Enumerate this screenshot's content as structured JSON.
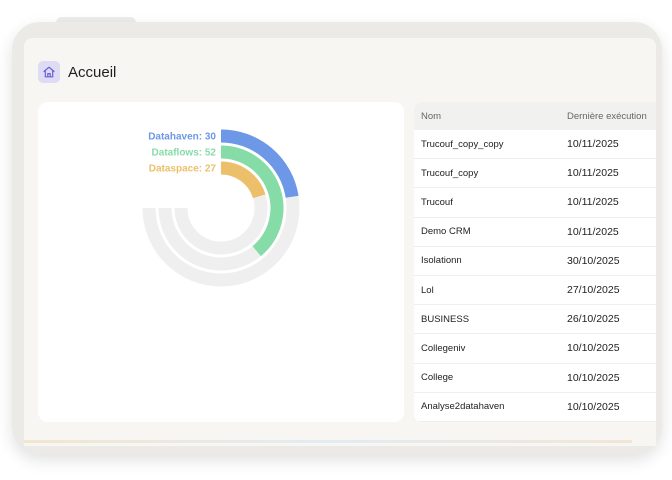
{
  "header": {
    "title": "Accueil",
    "icon": "home-icon",
    "icon_bg": "#dedbf4",
    "icon_color": "#6a5fd6"
  },
  "chart_data": {
    "type": "radial-bar",
    "max": 100,
    "track_color": "#efefef",
    "series": [
      {
        "name": "Datahaven",
        "value": 30,
        "label": "Datahaven: 30",
        "color": "#6d98e8"
      },
      {
        "name": "Dataflows",
        "value": 52,
        "label": "Dataflows: 52",
        "color": "#86dca6"
      },
      {
        "name": "Dataspace",
        "value": 27,
        "label": "Dataspace: 27",
        "color": "#ecc06a"
      }
    ]
  },
  "table": {
    "columns": [
      "Nom",
      "Dernière exécution"
    ],
    "rows": [
      {
        "name": "Trucouf_copy_copy",
        "date": "10/11/2025"
      },
      {
        "name": "Trucouf_copy",
        "date": "10/11/2025"
      },
      {
        "name": "Trucouf",
        "date": "10/11/2025"
      },
      {
        "name": "Demo CRM",
        "date": "10/11/2025"
      },
      {
        "name": "Isolationn",
        "date": "30/10/2025"
      },
      {
        "name": "Lol",
        "date": "27/10/2025"
      },
      {
        "name": "BUSINESS",
        "date": "26/10/2025"
      },
      {
        "name": "Collegeniv",
        "date": "10/10/2025"
      },
      {
        "name": "College",
        "date": "10/10/2025"
      },
      {
        "name": "Analyse2datahaven",
        "date": "10/10/2025"
      }
    ]
  }
}
